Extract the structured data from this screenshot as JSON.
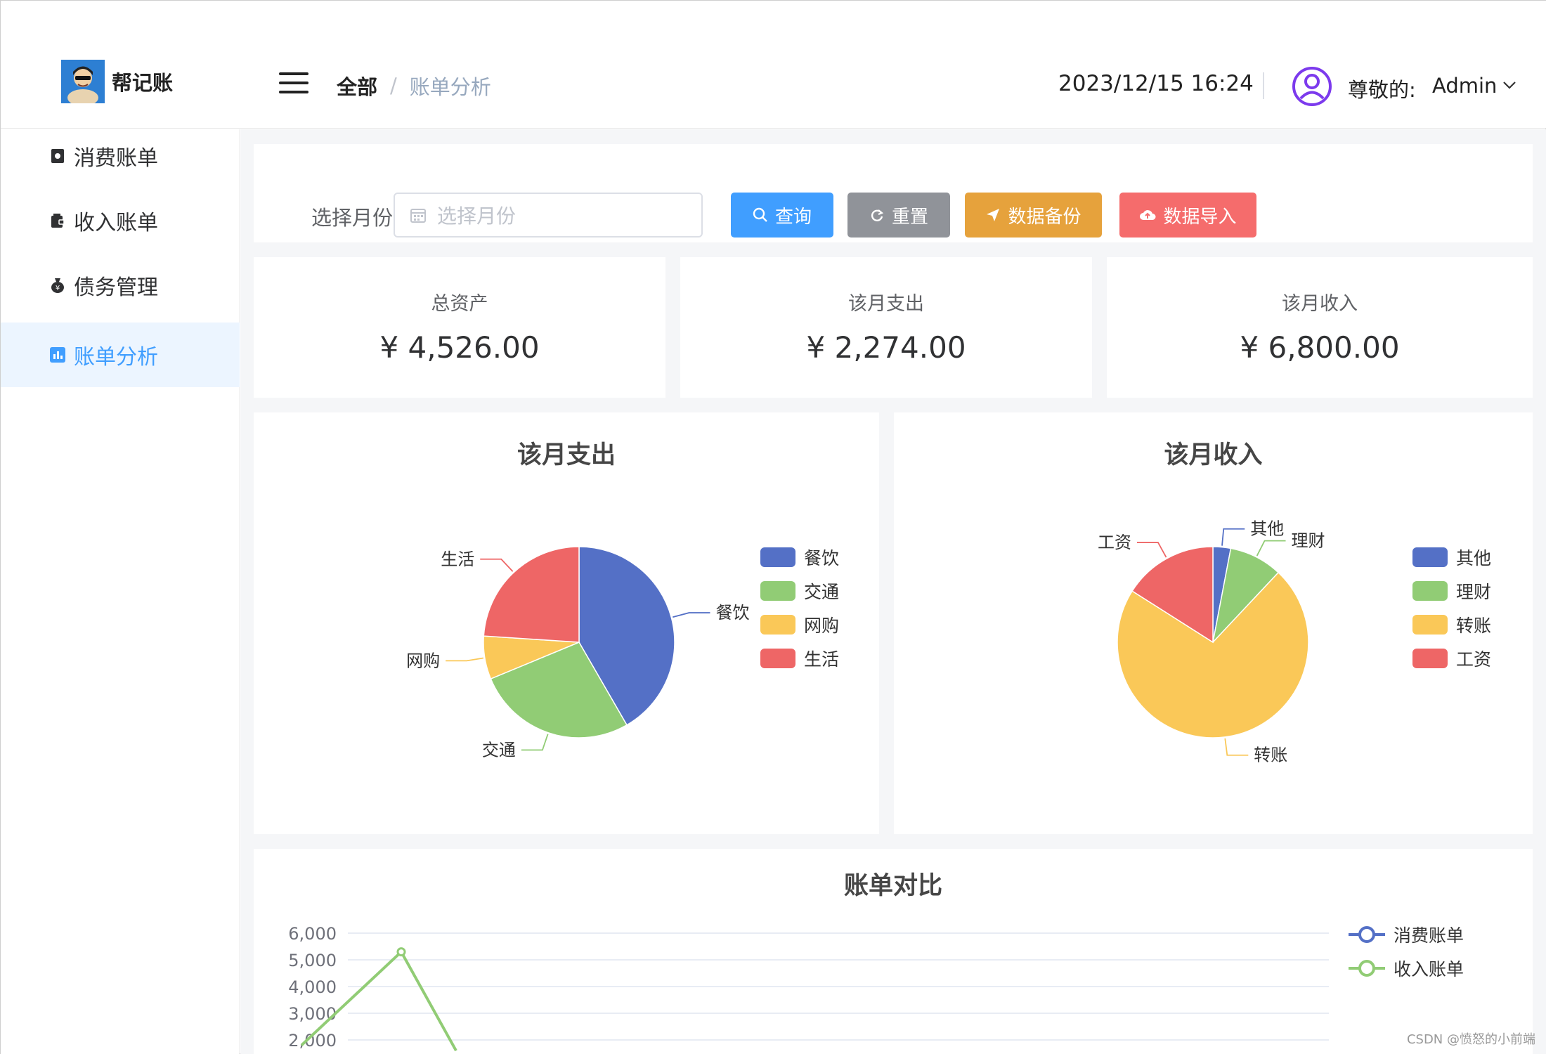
{
  "app": {
    "name": "帮记账"
  },
  "window_controls": {
    "minimize": "minimize-icon",
    "maximize": "maximize-icon",
    "close": "close-icon"
  },
  "header": {
    "breadcrumb": {
      "root": "全部",
      "separator": "/",
      "current": "账单分析"
    },
    "datetime": "2023/12/15 16:24",
    "greeting": "尊敬的:",
    "username": "Admin"
  },
  "sidebar": {
    "items": [
      {
        "label": "消费账单",
        "icon": "receipt-icon",
        "active": false
      },
      {
        "label": "收入账单",
        "icon": "wallet-icon",
        "active": false
      },
      {
        "label": "债务管理",
        "icon": "money-bag-icon",
        "active": false
      },
      {
        "label": "账单分析",
        "icon": "bar-chart-icon",
        "active": true
      }
    ]
  },
  "filter": {
    "label": "选择月份",
    "placeholder": "选择月份",
    "buttons": {
      "query": "查询",
      "reset": "重置",
      "backup": "数据备份",
      "import": "数据导入"
    }
  },
  "colors": {
    "primary": "#409eff",
    "info": "#909399",
    "warning": "#e6a23c",
    "danger": "#f56c6c",
    "pie_blue": "#5470c6",
    "pie_green": "#91cc75",
    "pie_yellow": "#fac858",
    "pie_red": "#ee6666"
  },
  "stats": [
    {
      "label": "总资产",
      "value": "¥ 4,526.00"
    },
    {
      "label": "该月支出",
      "value": "¥ 2,274.00"
    },
    {
      "label": "该月收入",
      "value": "¥ 6,800.00"
    }
  ],
  "chart_data": [
    {
      "type": "pie",
      "title": "该月支出",
      "categories": [
        "餐饮",
        "交通",
        "网购",
        "生活"
      ],
      "values": [
        40,
        26,
        7,
        23
      ],
      "legend": "right",
      "colors": [
        "#5470c6",
        "#91cc75",
        "#fac858",
        "#ee6666"
      ]
    },
    {
      "type": "pie",
      "title": "该月收入",
      "categories": [
        "其他",
        "理财",
        "转账",
        "工资"
      ],
      "values": [
        3,
        9,
        72,
        16
      ],
      "legend": "right",
      "colors": [
        "#5470c6",
        "#91cc75",
        "#fac858",
        "#ee6666"
      ]
    },
    {
      "type": "line",
      "title": "账单对比",
      "yticks": [
        "6,000",
        "5,000",
        "4,000",
        "3,000",
        "2,000"
      ],
      "ylim": [
        2000,
        6000
      ],
      "series": [
        {
          "name": "消费账单",
          "color": "#5470c6"
        },
        {
          "name": "收入账单",
          "color": "#91cc75",
          "visible_points": [
            [
              0,
              1800
            ],
            [
              1,
              5300
            ],
            [
              2,
              1600
            ]
          ]
        }
      ],
      "legend": "right",
      "grid": true
    }
  ],
  "watermark": "CSDN @愤怒的小前端"
}
